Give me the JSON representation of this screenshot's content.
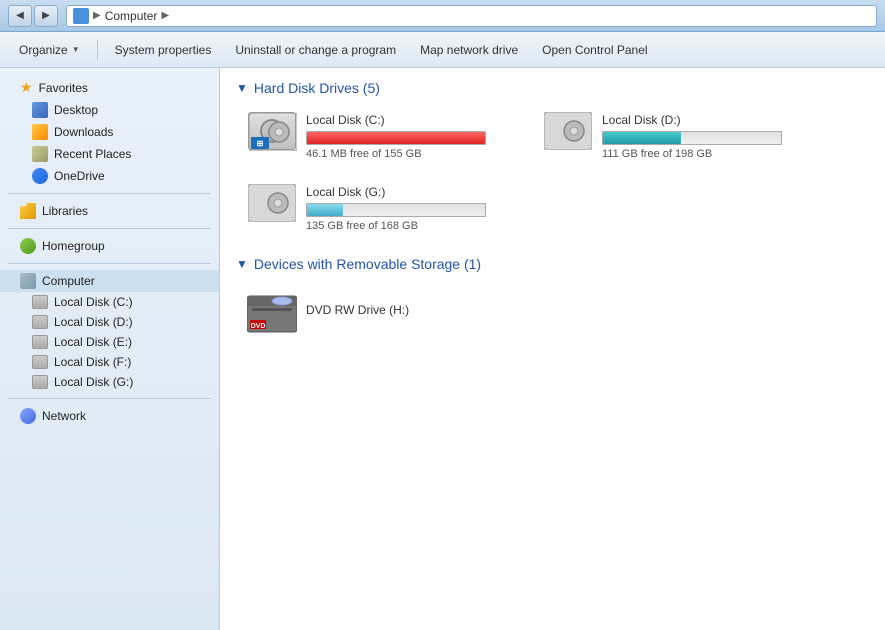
{
  "titlebar": {
    "address": "Computer",
    "arrow": "▶"
  },
  "toolbar": {
    "organize_label": "Organize",
    "system_properties_label": "System properties",
    "uninstall_label": "Uninstall or change a program",
    "map_network_label": "Map network drive",
    "open_control_panel_label": "Open Control Panel"
  },
  "sidebar": {
    "favorites_label": "Favorites",
    "desktop_label": "Desktop",
    "downloads_label": "Downloads",
    "recent_places_label": "Recent Places",
    "onedrive_label": "OneDrive",
    "libraries_label": "Libraries",
    "homegroup_label": "Homegroup",
    "computer_label": "Computer",
    "computer_sub": [
      "Local Disk (C:)",
      "Local Disk (D:)",
      "Local Disk (E:)",
      "Local Disk (F:)",
      "Local Disk (G:)"
    ],
    "network_label": "Network"
  },
  "content": {
    "hard_disk_section_title": "Hard Disk Drives (5)",
    "removable_section_title": "Devices with Removable Storage (1)",
    "drives": [
      {
        "name": "Local Disk (C:)",
        "free_text": "46.1 MB free of 155 GB",
        "fill_percent": 99.97,
        "bar_color": "red"
      },
      {
        "name": "Local Disk (D:)",
        "free_text": "111 GB free of 198 GB",
        "fill_percent": 44,
        "bar_color": "teal"
      },
      {
        "name": "Local Disk (G:)",
        "free_text": "135 GB free of 168 GB",
        "fill_percent": 20,
        "bar_color": "blue-light"
      }
    ],
    "removable_drives": [
      {
        "name": "DVD RW Drive (H:)"
      }
    ]
  }
}
